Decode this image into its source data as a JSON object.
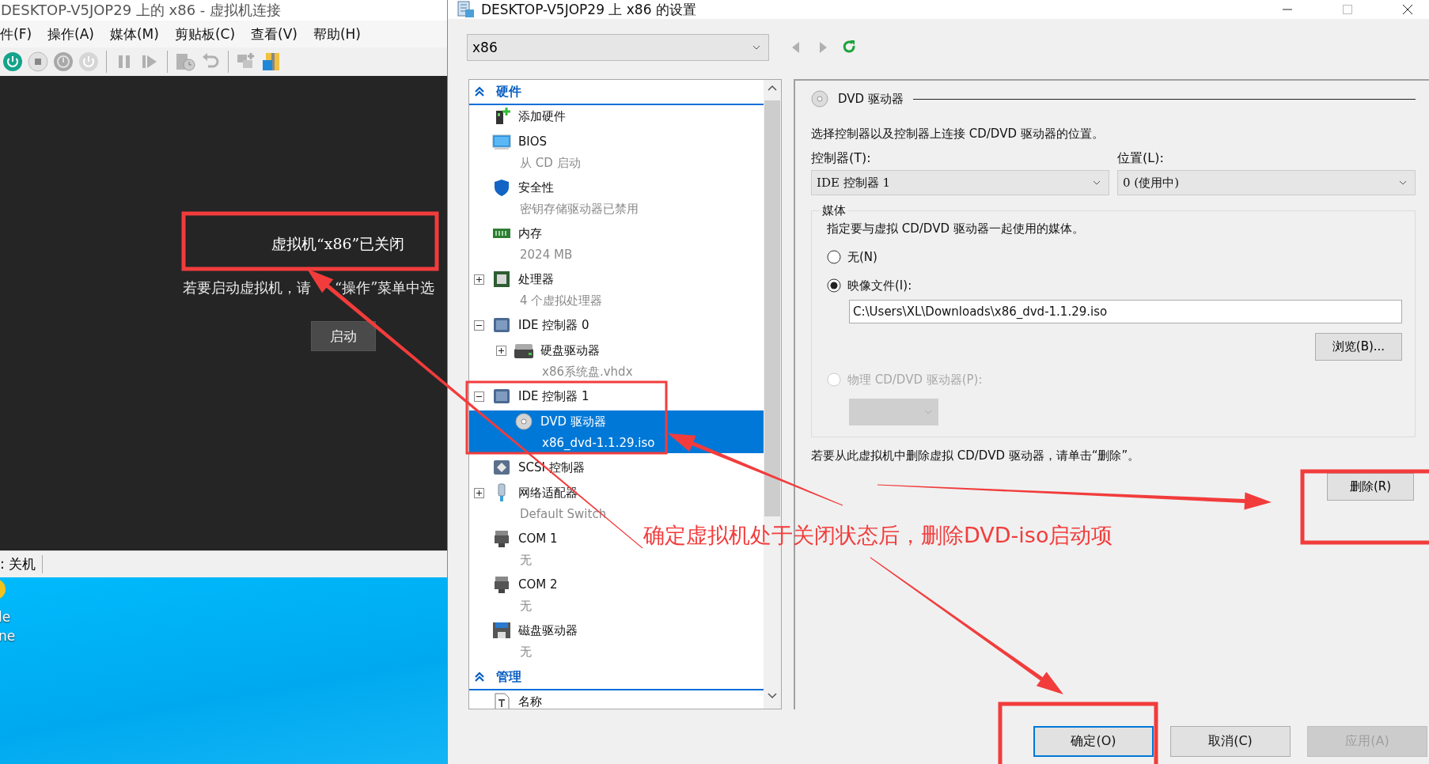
{
  "vm_window": {
    "title": "DESKTOP-V5JOP29 上的 x86 - 虚拟机连接",
    "menu": [
      "件(F)",
      "操作(A)",
      "媒体(M)",
      "剪贴板(C)",
      "查看(V)",
      "帮助(H)"
    ],
    "toolbar": [
      {
        "kind": "power-on",
        "disabled": false
      },
      {
        "kind": "stop",
        "disabled": true
      },
      {
        "kind": "shutdown",
        "disabled": true
      },
      {
        "kind": "power",
        "disabled": true
      },
      {
        "kind": "separator"
      },
      {
        "kind": "pause",
        "disabled": true
      },
      {
        "kind": "resume",
        "disabled": true
      },
      {
        "kind": "separator"
      },
      {
        "kind": "checkpoint",
        "disabled": true
      },
      {
        "kind": "revert",
        "disabled": true
      },
      {
        "kind": "separator"
      },
      {
        "kind": "network",
        "disabled": true
      },
      {
        "kind": "share",
        "disabled": false
      }
    ],
    "display": {
      "message": "虚拟机“x86”已关闭",
      "hint_visible_parts": [
        "若要启动虚拟机，请",
        "“操作”菜单中选"
      ],
      "start_button": "启动"
    },
    "status_bar": ": 关机"
  },
  "desktop": {
    "icon_labels": [
      "le",
      "ne"
    ]
  },
  "settings_dialog": {
    "title": "DESKTOP-V5JOP29 上 x86 的设置",
    "vm_selector": "x86",
    "nav": [
      {
        "kind": "back",
        "disabled": true
      },
      {
        "kind": "forward",
        "disabled": true
      },
      {
        "kind": "refresh",
        "disabled": false
      }
    ],
    "tree": {
      "sections": [
        {
          "title": "硬件",
          "expanded": true,
          "items": [
            {
              "kind": "add-hardware",
              "label": "添加硬件",
              "selected": false
            },
            {
              "kind": "bios",
              "label": "BIOS",
              "detail": "从 CD 启动",
              "selected": false
            },
            {
              "kind": "security",
              "label": "安全性",
              "detail": "密钥存储驱动器已禁用",
              "selected": false
            },
            {
              "kind": "memory",
              "label": "内存",
              "detail": "2024 MB",
              "selected": false
            },
            {
              "kind": "processor",
              "label": "处理器",
              "detail": "4 个虚拟处理器",
              "selected": false,
              "expanded": false
            },
            {
              "kind": "controller",
              "label": "IDE 控制器 0",
              "selected": false,
              "expanded": true,
              "children": [
                {
                  "kind": "hard-drive",
                  "label": "硬盘驱动器",
                  "detail": "x86系统盘.vhdx",
                  "selected": false,
                  "expanded": false
                }
              ]
            },
            {
              "kind": "controller",
              "label": "IDE 控制器 1",
              "selected": false,
              "expanded": true,
              "children": [
                {
                  "kind": "dvd",
                  "label": "DVD 驱动器",
                  "detail": "x86_dvd-1.1.29.iso",
                  "selected": true
                }
              ]
            },
            {
              "kind": "scsi",
              "label": "SCSI 控制器",
              "selected": false
            },
            {
              "kind": "network",
              "label": "网络适配器",
              "detail": "Default Switch",
              "selected": false,
              "expanded": false
            },
            {
              "kind": "com",
              "label": "COM 1",
              "detail": "无",
              "selected": false
            },
            {
              "kind": "com",
              "label": "COM 2",
              "detail": "无",
              "selected": false
            },
            {
              "kind": "floppy",
              "label": "磁盘驱动器",
              "detail": "无",
              "selected": false
            }
          ]
        },
        {
          "title": "管理",
          "expanded": true,
          "items": [
            {
              "kind": "name",
              "label": "名称",
              "selected": false
            }
          ]
        }
      ]
    },
    "detail": {
      "title": "DVD 驱动器",
      "description": "选择控制器以及控制器上连接 CD/DVD 驱动器的位置。",
      "controller": {
        "label": "控制器(T):",
        "value": "IDE 控制器 1"
      },
      "location": {
        "label": "位置(L):",
        "value": "0 (使用中)"
      },
      "media": {
        "legend": "媒体",
        "description": "指定要与虚拟 CD/DVD 驱动器一起使用的媒体。",
        "options": [
          {
            "kind": "none",
            "label": "无(N)",
            "selected": false,
            "disabled": false
          },
          {
            "kind": "file",
            "label": "映像文件(I):",
            "selected": true,
            "disabled": false
          },
          {
            "kind": "physical",
            "label": "物理 CD/DVD 驱动器(P):",
            "selected": false,
            "disabled": true
          }
        ],
        "path": "C:\\Users\\XL\\Downloads\\x86_dvd-1.1.29.iso",
        "browse_button": "浏览(B)..."
      },
      "remove_hint": "若要从此虚拟机中删除虚拟 CD/DVD 驱动器，请单击“删除”。",
      "remove_button": "删除(R)"
    },
    "buttons": [
      {
        "label": "确定(O)",
        "default": true,
        "disabled": false
      },
      {
        "label": "取消(C)",
        "default": false,
        "disabled": false
      },
      {
        "label": "应用(A)",
        "default": false,
        "disabled": true
      }
    ]
  },
  "annotation": {
    "note": "确定虚拟机处于关闭状态后，删除DVD-iso启动项"
  }
}
